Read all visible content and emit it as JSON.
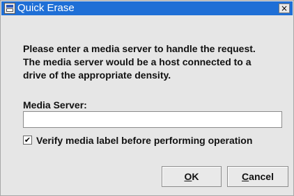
{
  "window": {
    "title": "Quick Erase",
    "close_glyph": "×",
    "icon": "media-erase-icon"
  },
  "message": {
    "lines": [
      "Please enter a media server to handle the request.",
      "The media server would be a host connected to a",
      "drive of the appropriate density."
    ]
  },
  "media_server": {
    "label": "Media Server:",
    "value": ""
  },
  "verify": {
    "label": "Verify media label before performing operation",
    "checked": true,
    "check_glyph": "✔"
  },
  "buttons": {
    "ok": {
      "mnemonic": "O",
      "rest": "K"
    },
    "cancel": {
      "mnemonic": "C",
      "rest": "ancel"
    }
  },
  "colors": {
    "titlebar": "#1f6fd6",
    "window_bg": "#e6e6e6"
  }
}
